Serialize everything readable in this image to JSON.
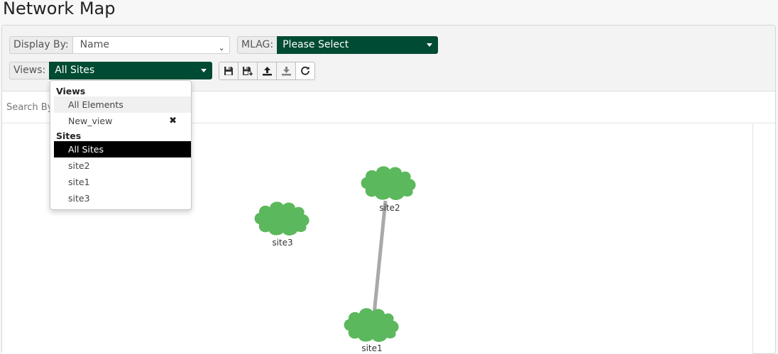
{
  "page": {
    "title": "Network Map"
  },
  "toolbar": {
    "display_by": {
      "label": "Display By:",
      "value": "Name"
    },
    "mlag": {
      "label": "MLAG:",
      "value": "Please Select"
    },
    "views": {
      "label": "Views:",
      "value": "All Sites"
    },
    "buttons": [
      {
        "icon": "save-icon"
      },
      {
        "icon": "save-as-icon"
      },
      {
        "icon": "upload-icon"
      },
      {
        "icon": "download-icon"
      },
      {
        "icon": "refresh-icon"
      }
    ]
  },
  "search": {
    "label": "Search By"
  },
  "views_dropdown": {
    "groups": [
      {
        "header": "Views",
        "items": [
          {
            "label": "All Elements",
            "state": "hover"
          },
          {
            "label": "New_view",
            "removable": true,
            "remove_glyph": "✖"
          }
        ]
      },
      {
        "header": "Sites",
        "items": [
          {
            "label": "All Sites",
            "state": "selected"
          },
          {
            "label": "site2"
          },
          {
            "label": "site1"
          },
          {
            "label": "site3"
          }
        ]
      }
    ]
  },
  "map": {
    "nodes": [
      {
        "id": "site2",
        "label": "site2"
      },
      {
        "id": "site3",
        "label": "site3"
      },
      {
        "id": "site1",
        "label": "site1"
      }
    ],
    "links": [
      {
        "from": "site2",
        "to": "site1"
      }
    ],
    "colors": {
      "node": "#5cb85c",
      "link": "#a9a9a9",
      "accent": "#004b33"
    }
  }
}
